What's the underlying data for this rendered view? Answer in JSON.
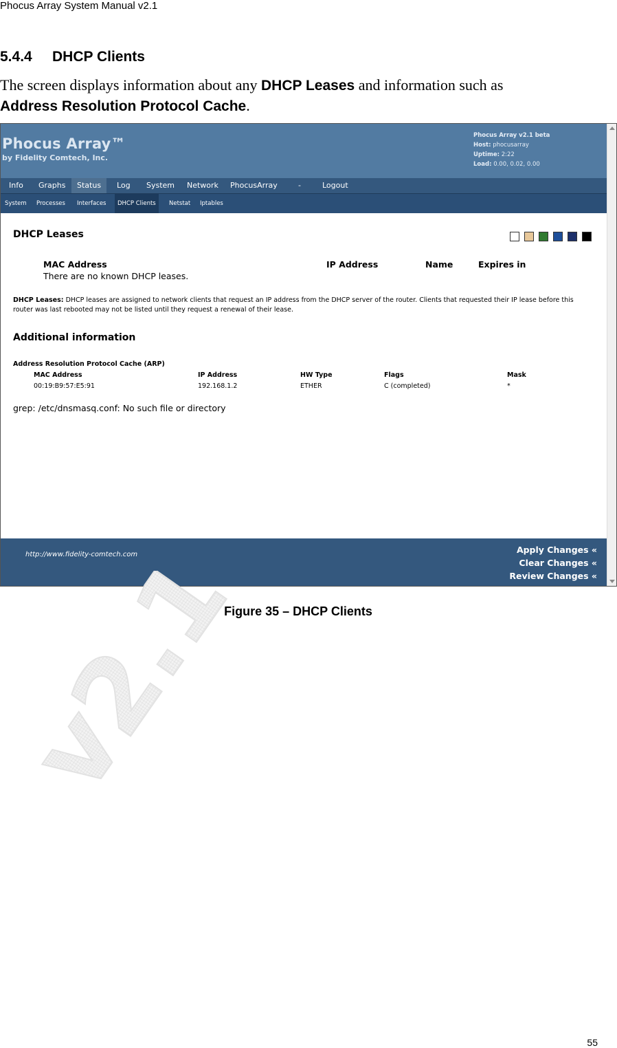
{
  "doc": {
    "header": "Phocus Array System Manual v2.1",
    "section_number": "5.4.4",
    "section_title": "DHCP Clients",
    "intro_part1": "The screen displays information about any ",
    "intro_bold1": "DHCP Leases",
    "intro_part2": " and information such as ",
    "intro_bold2": "Address Resolution Protocol Cache",
    "intro_end": ".",
    "caption": "Figure 35 – DHCP Clients",
    "page_number": "55",
    "watermark": "v2.1"
  },
  "app": {
    "title": "Phocus Array™",
    "subtitle": "by Fidelity Comtech, Inc.",
    "sysinfo": {
      "version": "Phocus Array v2.1 beta",
      "host_label": "Host:",
      "host": "phocusarray",
      "uptime_label": "Uptime:",
      "uptime": "2:22",
      "load_label": "Load:",
      "load": "0.00, 0.02, 0.00"
    },
    "main_nav": [
      "Info",
      "Graphs",
      "Status",
      "Log",
      "System",
      "Network",
      "PhocusArray",
      "-",
      "Logout"
    ],
    "sub_nav": [
      "System",
      "Processes",
      "Interfaces",
      "DHCP Clients",
      "Netstat",
      "Iptables"
    ],
    "theme_swatches": [
      "#ffffff",
      "#e8c89a",
      "#2f7a2f",
      "#1e4f9a",
      "#1c2f6a",
      "#000000"
    ]
  },
  "dhcp": {
    "heading": "DHCP Leases",
    "columns": [
      "MAC Address",
      "IP Address",
      "Name",
      "Expires in"
    ],
    "empty_message": "There are no known DHCP leases.",
    "note_label": "DHCP Leases:",
    "note_text": " DHCP leases are assigned to network clients that request an IP address from the DHCP server of the router. Clients that requested their IP lease before this router was last rebooted may not be listed until they request a renewal of their lease."
  },
  "additional": {
    "heading": "Additional information",
    "arp_title": "Address Resolution Protocol Cache (ARP)",
    "arp_columns": [
      "MAC Address",
      "IP Address",
      "HW Type",
      "Flags",
      "Mask"
    ],
    "arp_rows": [
      [
        "00:19:B9:57:E5:91",
        "192.168.1.2",
        "ETHER",
        "C (completed)",
        "*"
      ]
    ],
    "grep_error": "grep: /etc/dnsmasq.conf: No such file or directory"
  },
  "footer": {
    "url": "http://www.fidelity-comtech.com",
    "apply": "Apply Changes «",
    "clear": "Clear Changes «",
    "review": "Review Changes «"
  }
}
